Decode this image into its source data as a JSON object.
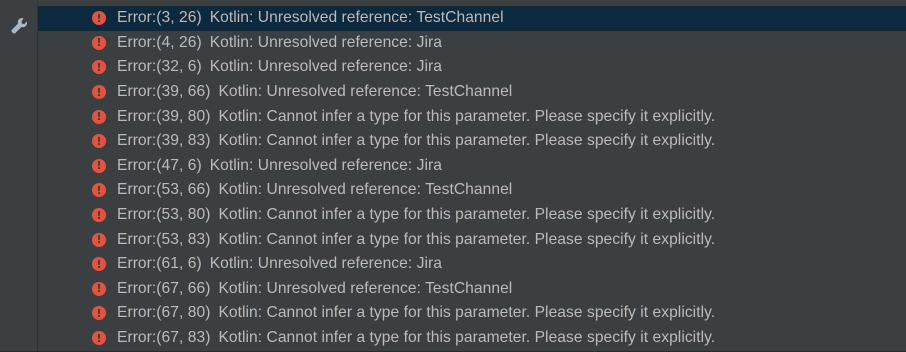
{
  "toolbar": {
    "icon": "wrench-icon"
  },
  "messages": [
    {
      "type": "Error",
      "location": "(3, 26)",
      "text": "Kotlin: Unresolved reference: TestChannel",
      "selected": true
    },
    {
      "type": "Error",
      "location": "(4, 26)",
      "text": "Kotlin: Unresolved reference: Jira"
    },
    {
      "type": "Error",
      "location": "(32, 6)",
      "text": "Kotlin: Unresolved reference: Jira"
    },
    {
      "type": "Error",
      "location": "(39, 66)",
      "text": "Kotlin: Unresolved reference: TestChannel"
    },
    {
      "type": "Error",
      "location": "(39, 80)",
      "text": "Kotlin: Cannot infer a type for this parameter. Please specify it explicitly."
    },
    {
      "type": "Error",
      "location": "(39, 83)",
      "text": "Kotlin: Cannot infer a type for this parameter. Please specify it explicitly."
    },
    {
      "type": "Error",
      "location": "(47, 6)",
      "text": "Kotlin: Unresolved reference: Jira"
    },
    {
      "type": "Error",
      "location": "(53, 66)",
      "text": "Kotlin: Unresolved reference: TestChannel"
    },
    {
      "type": "Error",
      "location": "(53, 80)",
      "text": "Kotlin: Cannot infer a type for this parameter. Please specify it explicitly."
    },
    {
      "type": "Error",
      "location": "(53, 83)",
      "text": "Kotlin: Cannot infer a type for this parameter. Please specify it explicitly."
    },
    {
      "type": "Error",
      "location": "(61, 6)",
      "text": "Kotlin: Unresolved reference: Jira"
    },
    {
      "type": "Error",
      "location": "(67, 66)",
      "text": "Kotlin: Unresolved reference: TestChannel"
    },
    {
      "type": "Error",
      "location": "(67, 80)",
      "text": "Kotlin: Cannot infer a type for this parameter. Please specify it explicitly."
    },
    {
      "type": "Error",
      "location": "(67, 83)",
      "text": "Kotlin: Cannot infer a type for this parameter. Please specify it explicitly."
    }
  ],
  "colors": {
    "background": "#3c3f41",
    "selected_row": "#0d293e",
    "error_icon": "#e5523e",
    "text": "#bbbbbb"
  }
}
